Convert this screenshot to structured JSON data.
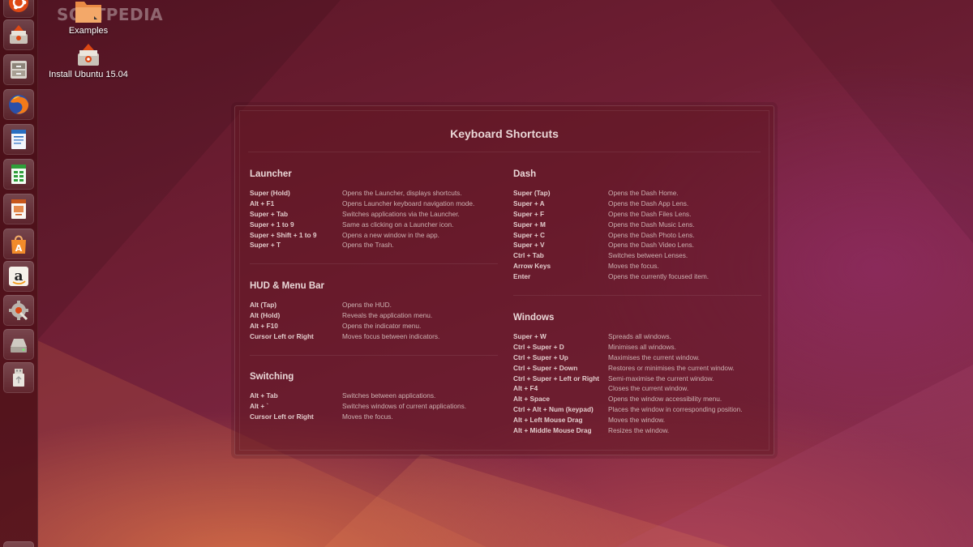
{
  "watermark": "SOFTPEDIA",
  "desktop_icons": [
    {
      "name": "Examples",
      "icon": "folder-icon"
    },
    {
      "name": "Install Ubuntu 15.04",
      "icon": "installer-icon"
    }
  ],
  "launcher": {
    "items": [
      {
        "name": "dash-home",
        "icon": "ubuntu-logo-icon"
      },
      {
        "name": "files-installer",
        "icon": "installer-icon"
      },
      {
        "name": "files",
        "icon": "file-cabinet-icon"
      },
      {
        "name": "firefox",
        "icon": "firefox-icon"
      },
      {
        "name": "writer",
        "icon": "writer-document-icon"
      },
      {
        "name": "calc",
        "icon": "spreadsheet-icon"
      },
      {
        "name": "impress",
        "icon": "presentation-icon"
      },
      {
        "name": "software-center",
        "icon": "shopping-bag-icon"
      },
      {
        "name": "amazon",
        "icon": "amazon-icon"
      },
      {
        "name": "system-settings",
        "icon": "settings-icon"
      },
      {
        "name": "drive",
        "icon": "drive-icon"
      },
      {
        "name": "usb",
        "icon": "usb-drive-icon"
      }
    ]
  },
  "panel": {
    "title": "Keyboard Shortcuts",
    "left_sections": [
      {
        "heading": "Launcher",
        "rows": [
          {
            "key": "Super (Hold)",
            "desc": "Opens the Launcher, displays shortcuts."
          },
          {
            "key": "Alt + F1",
            "desc": "Opens Launcher keyboard navigation mode."
          },
          {
            "key": "Super + Tab",
            "desc": "Switches applications via the Launcher."
          },
          {
            "key": "Super + 1 to 9",
            "desc": "Same as clicking on a Launcher icon."
          },
          {
            "key": "Super + Shift + 1 to 9",
            "desc": "Opens a new window in the app."
          },
          {
            "key": "Super + T",
            "desc": "Opens the Trash."
          }
        ]
      },
      {
        "heading": "HUD & Menu Bar",
        "rows": [
          {
            "key": "Alt (Tap)",
            "desc": "Opens the HUD."
          },
          {
            "key": "Alt (Hold)",
            "desc": "Reveals the application menu."
          },
          {
            "key": "Alt + F10",
            "desc": "Opens the indicator menu."
          },
          {
            "key": "Cursor Left or Right",
            "desc": "Moves focus between indicators."
          }
        ]
      },
      {
        "heading": "Switching",
        "rows": [
          {
            "key": "Alt + Tab",
            "desc": "Switches between applications."
          },
          {
            "key": "Alt + `",
            "desc": "Switches windows of current applications."
          },
          {
            "key": "Cursor Left or Right",
            "desc": "Moves the focus."
          }
        ]
      }
    ],
    "right_sections": [
      {
        "heading": "Dash",
        "rows": [
          {
            "key": "Super (Tap)",
            "desc": "Opens the Dash Home."
          },
          {
            "key": "Super + A",
            "desc": "Opens the Dash App Lens."
          },
          {
            "key": "Super + F",
            "desc": "Opens the Dash Files Lens."
          },
          {
            "key": "Super + M",
            "desc": "Opens the Dash Music Lens."
          },
          {
            "key": "Super + C",
            "desc": "Opens the Dash Photo Lens."
          },
          {
            "key": "Super + V",
            "desc": "Opens the Dash Video Lens."
          },
          {
            "key": "Ctrl + Tab",
            "desc": "Switches between Lenses."
          },
          {
            "key": "Arrow Keys",
            "desc": "Moves the focus."
          },
          {
            "key": "Enter",
            "desc": "Opens the currently focused item."
          }
        ]
      },
      {
        "heading": "Windows",
        "rows": [
          {
            "key": "Super + W",
            "desc": "Spreads all windows."
          },
          {
            "key": "Ctrl + Super + D",
            "desc": "Minimises all windows."
          },
          {
            "key": "Ctrl + Super + Up",
            "desc": "Maximises the current window."
          },
          {
            "key": "Ctrl + Super + Down",
            "desc": "Restores or minimises the current window."
          },
          {
            "key": "Ctrl + Super + Left or Right",
            "desc": "Semi-maximise the current window."
          },
          {
            "key": "Alt + F4",
            "desc": "Closes the current window."
          },
          {
            "key": "Alt + Space",
            "desc": "Opens the window accessibility menu."
          },
          {
            "key": "Ctrl + Alt + Num (keypad)",
            "desc": "Places the window in corresponding position."
          },
          {
            "key": "Alt + Left Mouse Drag",
            "desc": "Moves the window."
          },
          {
            "key": "Alt + Middle Mouse Drag",
            "desc": "Resizes the window."
          }
        ]
      }
    ]
  }
}
